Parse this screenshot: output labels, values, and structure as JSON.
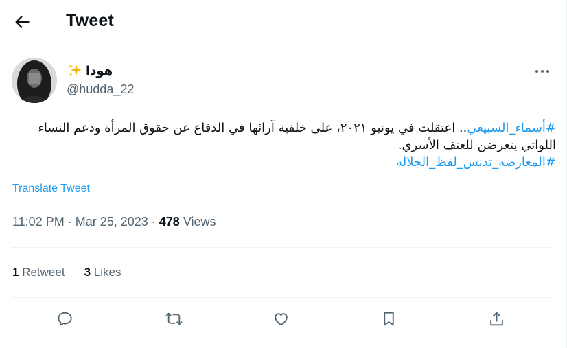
{
  "header": {
    "title": "Tweet",
    "back_icon": "arrow-left-icon"
  },
  "author": {
    "display_name": "هودا",
    "emoji_icon": "sparkles-icon",
    "handle": "@hudda_22"
  },
  "tweet": {
    "hashtag1": "#أسماء_السبيعي",
    "body": ".. اعتقلت في يونيو ٢٠٢١، على خلفية آرائها في الدفاع عن حقوق المرأة ودعم النساء اللواتي يتعرضن للعنف الأسري.",
    "hashtag2": "#المعارضه_تدنس_لفظ_الجلاله"
  },
  "translate_label": "Translate Tweet",
  "meta": {
    "time_date": "11:02 PM · Mar 25, 2023 · ",
    "views_count": "478",
    "views_label": " Views"
  },
  "stats": {
    "retweets_count": "1",
    "retweets_label": "Retweet",
    "likes_count": "3",
    "likes_label": "Likes"
  },
  "actions": [
    "reply-icon",
    "retweet-icon",
    "like-icon",
    "bookmark-icon",
    "share-icon"
  ],
  "colors": {
    "accent": "#1d9bf0",
    "text": "#0f1419",
    "secondary": "#536471",
    "divider": "#eff3f4"
  }
}
